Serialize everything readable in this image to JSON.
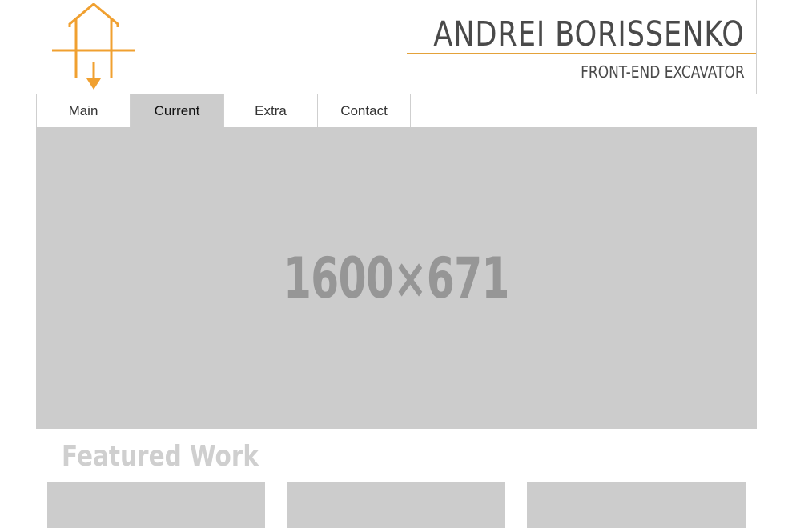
{
  "header": {
    "title": "ANDREI BORISSENKO",
    "subtitle": "FRONT-END EXCAVATOR",
    "logo_icon": "house-arrow-down-icon",
    "accent_color": "#f0a030"
  },
  "nav": {
    "tabs": [
      {
        "label": "Main"
      },
      {
        "label": "Current",
        "active": true
      },
      {
        "label": "Extra"
      },
      {
        "label": "Contact"
      }
    ]
  },
  "hero": {
    "placeholder_label": "1600×671",
    "background": "#cccccc"
  },
  "featured": {
    "heading": "Featured Work"
  }
}
